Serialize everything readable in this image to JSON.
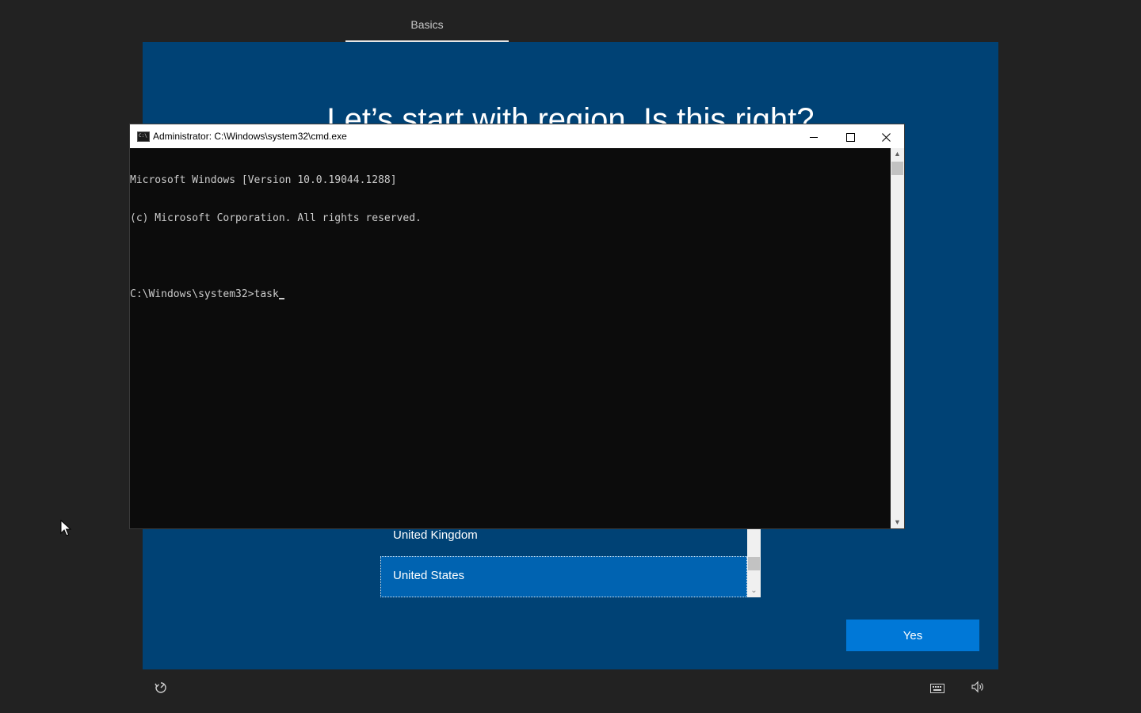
{
  "tabs": [
    {
      "label": "Basics",
      "active": true
    }
  ],
  "oobe": {
    "title": "Let’s start with region. Is this right?",
    "regions": [
      "United Kingdom",
      "United States"
    ],
    "selected_region": "United States",
    "yes_label": "Yes"
  },
  "bottom_bar": {
    "left_icon": "ease-of-access-icon",
    "right_icons": [
      "keyboard-icon",
      "volume-icon"
    ]
  },
  "cmd": {
    "title": "Administrator: C:\\Windows\\system32\\cmd.exe",
    "lines": [
      "Microsoft Windows [Version 10.0.19044.1288]",
      "(c) Microsoft Corporation. All rights reserved.",
      "",
      "C:\\Windows\\system32>task"
    ]
  },
  "colors": {
    "background": "#222222",
    "oobe_panel": "#004275",
    "accent": "#0078d7",
    "selected_item": "#0063b1",
    "console_bg": "#0c0c0c",
    "console_text": "#cccccc"
  }
}
